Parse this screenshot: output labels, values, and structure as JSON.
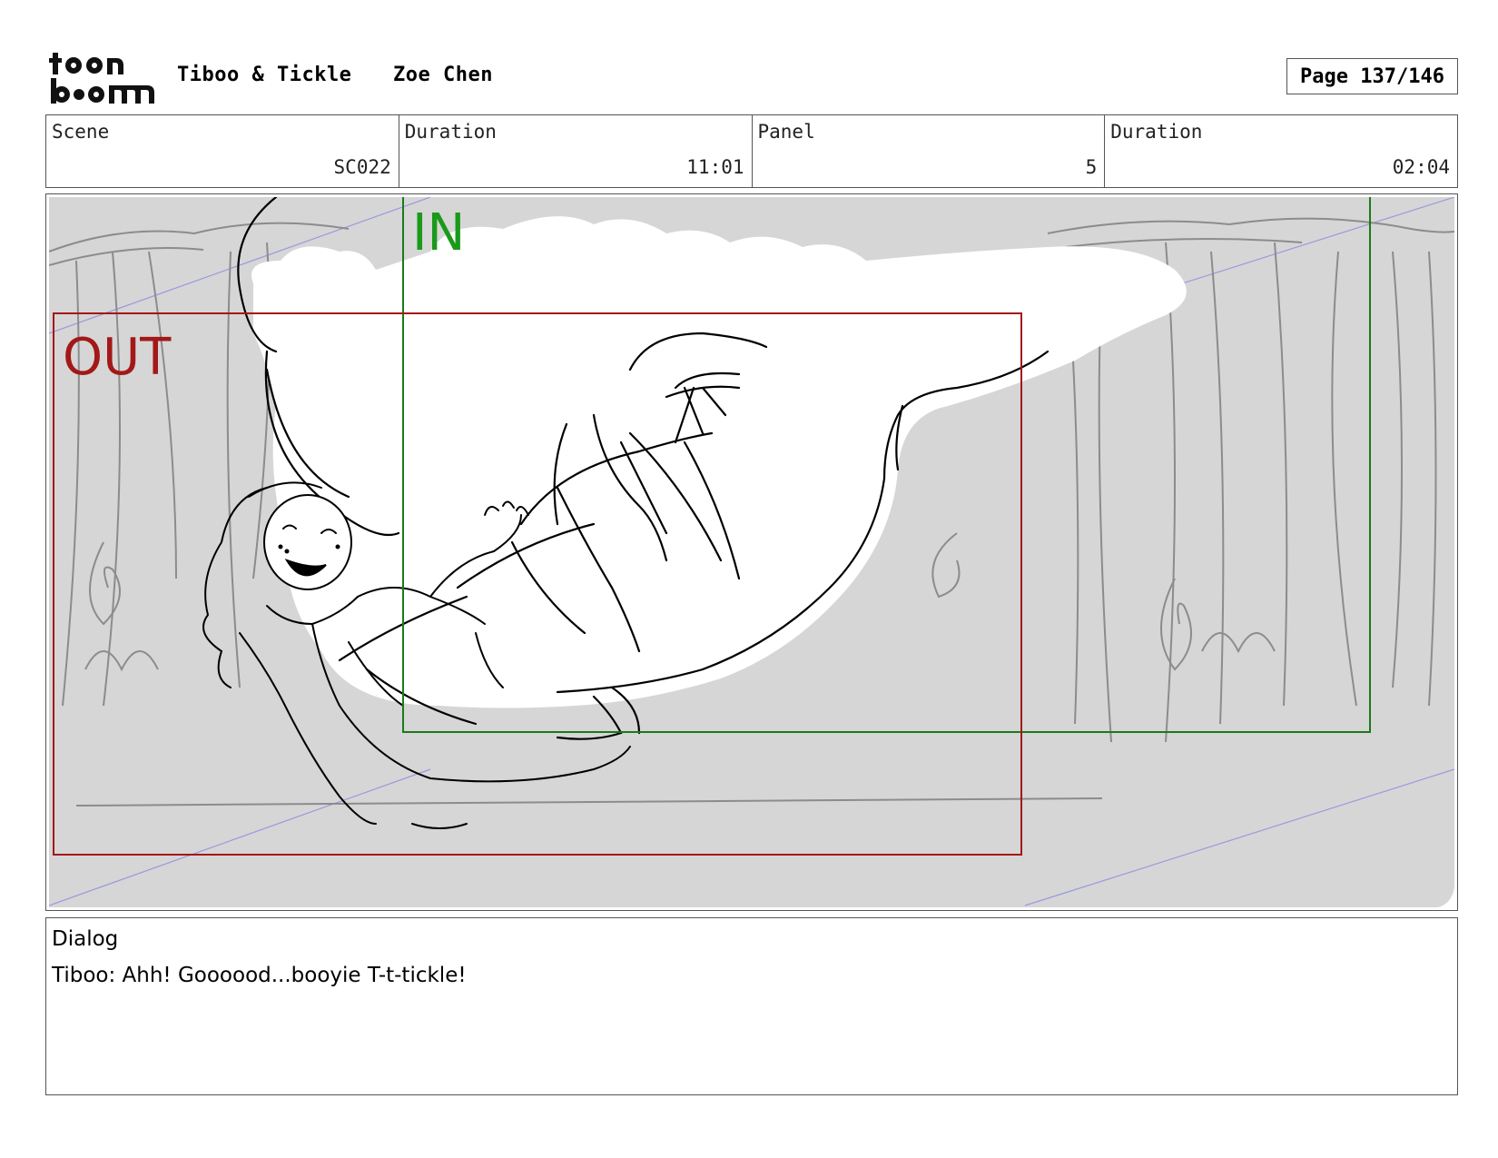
{
  "header": {
    "logo_text": "toon boom",
    "project_title": "Tiboo & Tickle",
    "artist": "Zoe Chen",
    "page": "Page 137/146"
  },
  "info": {
    "scene_label": "Scene",
    "scene_value": "SC022",
    "scene_duration_label": "Duration",
    "scene_duration_value": "11:01",
    "panel_label": "Panel",
    "panel_value": "5",
    "panel_duration_label": "Duration",
    "panel_duration_value": "02:04"
  },
  "panel": {
    "in_label": "IN",
    "out_label": "OUT",
    "in_color": "#1a9a1a",
    "out_color": "#a31818",
    "background_color": "#d6d6d6"
  },
  "dialog": {
    "label": "Dialog",
    "text": "Tiboo: Ahh! Goooood...booyie T-t-tickle!"
  }
}
